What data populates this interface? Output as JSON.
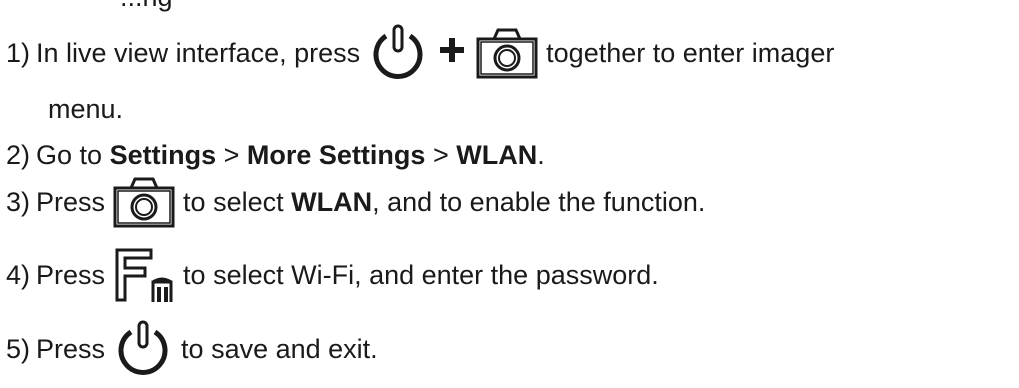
{
  "header_fragment": "...ng",
  "steps": [
    {
      "num": "1)",
      "text_before": "In live view interface, press",
      "text_after": "together to enter imager",
      "text_wrap": "menu.",
      "icons": [
        "power-icon",
        "camera-icon"
      ],
      "plus": "+"
    },
    {
      "num": "2)",
      "text_before": "Go to",
      "settings": "Settings",
      "sep1": ">",
      "more_settings": "More Settings",
      "sep2": ">",
      "wlan": "WLAN",
      "end": "."
    },
    {
      "num": "3)",
      "text_before": "Press",
      "text_mid": "to select",
      "wlan": "WLAN",
      "text_after": ", and to enable the function.",
      "icons": [
        "camera-icon"
      ]
    },
    {
      "num": "4)",
      "text_before": "Press",
      "text_after": "to select Wi-Fi, and enter the password.",
      "icons": [
        "fn-icon"
      ]
    },
    {
      "num": "5)",
      "text_before": "Press",
      "text_after": "to save and exit.",
      "icons": [
        "power-icon"
      ]
    }
  ]
}
